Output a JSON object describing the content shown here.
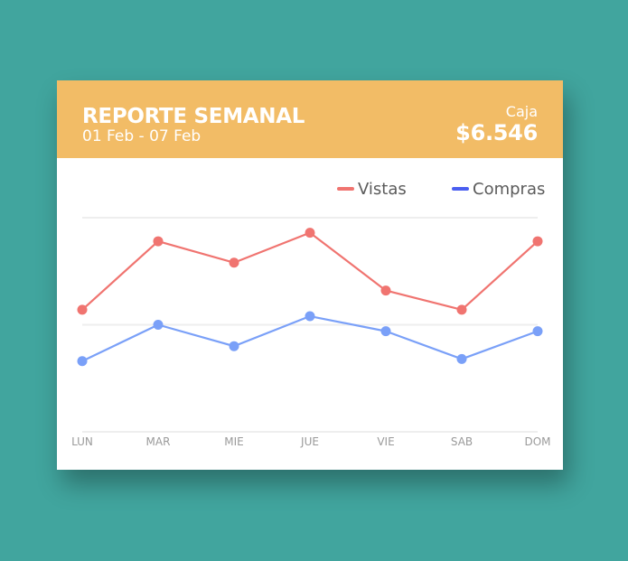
{
  "header": {
    "title": "REPORTE SEMANAL",
    "date_range": "01 Feb - 07 Feb",
    "cash_label": "Caja",
    "cash_amount": "$6.546",
    "background_color": "#f2bc66"
  },
  "page_background": "#41a59e",
  "chart_data": {
    "type": "line",
    "categories": [
      "LUN",
      "MAR",
      "MIE",
      "JUE",
      "VIE",
      "SAB",
      "DOM"
    ],
    "series": [
      {
        "name": "Vistas",
        "color": "#f07470",
        "values": [
          57,
          89,
          79,
          93,
          66,
          57,
          89
        ]
      },
      {
        "name": "Compras",
        "color": "#7aa0f8",
        "values": [
          33,
          50,
          40,
          54,
          47,
          34,
          47
        ]
      }
    ],
    "legend_swatch_colors": [
      "#f07470",
      "#4a5ef0"
    ],
    "ylim": [
      0,
      100
    ],
    "gridlines": [
      0,
      50,
      100
    ],
    "grid": true,
    "legend_position": "top-right",
    "title": "",
    "xlabel": "",
    "ylabel": ""
  }
}
